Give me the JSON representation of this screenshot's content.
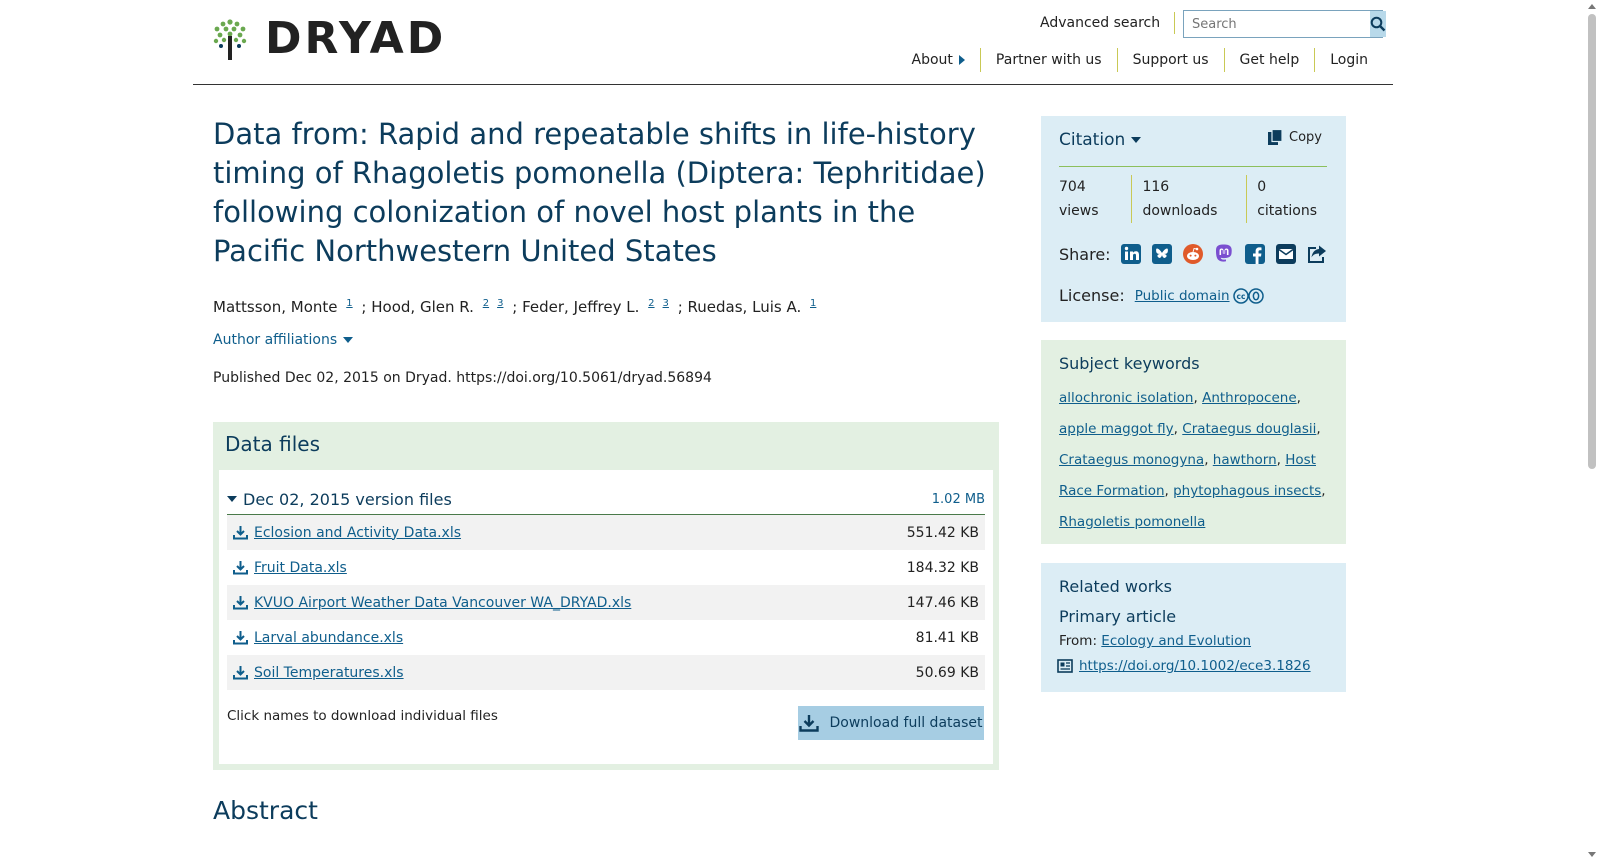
{
  "header": {
    "logo_text": "DRYAD",
    "advanced_search": "Advanced search",
    "search_placeholder": "Search",
    "nav": [
      "About",
      "Partner with us",
      "Support us",
      "Get help",
      "Login"
    ]
  },
  "dataset": {
    "title": "Data from: Rapid and repeatable shifts in life-history timing of Rhagoletis pomonella (Diptera: Tephritidae) following colonization of novel host plants in the Pacific Northwestern United States",
    "authors": [
      {
        "name": "Mattsson, Monte",
        "affil": [
          "1"
        ]
      },
      {
        "name": "Hood, Glen R.",
        "affil": [
          "2",
          "3"
        ]
      },
      {
        "name": "Feder, Jeffrey L.",
        "affil": [
          "2",
          "3"
        ]
      },
      {
        "name": "Ruedas, Luis A.",
        "affil": [
          "1"
        ]
      }
    ],
    "author_sep": ";",
    "affiliations_label": "Author affiliations",
    "published": "Published Dec 02, 2015 on Dryad. https://doi.org/10.5061/dryad.56894"
  },
  "files": {
    "heading": "Data files",
    "version_label": "Dec 02, 2015 version files",
    "version_size": "1.02 MB",
    "items": [
      {
        "name": "Eclosion and Activity Data.xls",
        "size": "551.42 KB"
      },
      {
        "name": "Fruit Data.xls",
        "size": "184.32 KB"
      },
      {
        "name": "KVUO Airport Weather Data Vancouver WA_DRYAD.xls",
        "size": "147.46 KB"
      },
      {
        "name": "Larval abundance.xls",
        "size": "81.41 KB"
      },
      {
        "name": "Soil Temperatures.xls",
        "size": "50.69 KB"
      }
    ],
    "note": "Click names to download individual files",
    "download_all": "Download full dataset"
  },
  "abstract_heading": "Abstract",
  "citation": {
    "heading": "Citation",
    "copy": "Copy",
    "metrics": [
      {
        "value": "704",
        "label": "views"
      },
      {
        "value": "116",
        "label": "downloads"
      },
      {
        "value": "0",
        "label": "citations"
      }
    ],
    "share_label": "Share:",
    "share_icons": [
      "linkedin-icon",
      "bluesky-icon",
      "reddit-icon",
      "mastodon-icon",
      "facebook-icon",
      "email-icon",
      "share-icon"
    ],
    "license_label": "License:",
    "license_value": "Public domain"
  },
  "keywords": {
    "heading": "Subject keywords",
    "items": [
      "allochronic isolation",
      "Anthropocene",
      "apple maggot fly",
      "Crataegus douglasii",
      "Crataegus monogyna",
      "hawthorn",
      "Host Race Formation",
      "phytophagous insects",
      "Rhagoletis pomonella"
    ]
  },
  "related": {
    "heading": "Related works",
    "type": "Primary article",
    "from_label": "From:",
    "from_value": "Ecology and Evolution",
    "doi": "https://doi.org/10.1002/ece3.1826"
  },
  "colors": {
    "accent": "#0f5e8c",
    "title": "#0c3c5c",
    "green_panel": "#e3f0e2",
    "blue_panel": "#dcedf5"
  }
}
